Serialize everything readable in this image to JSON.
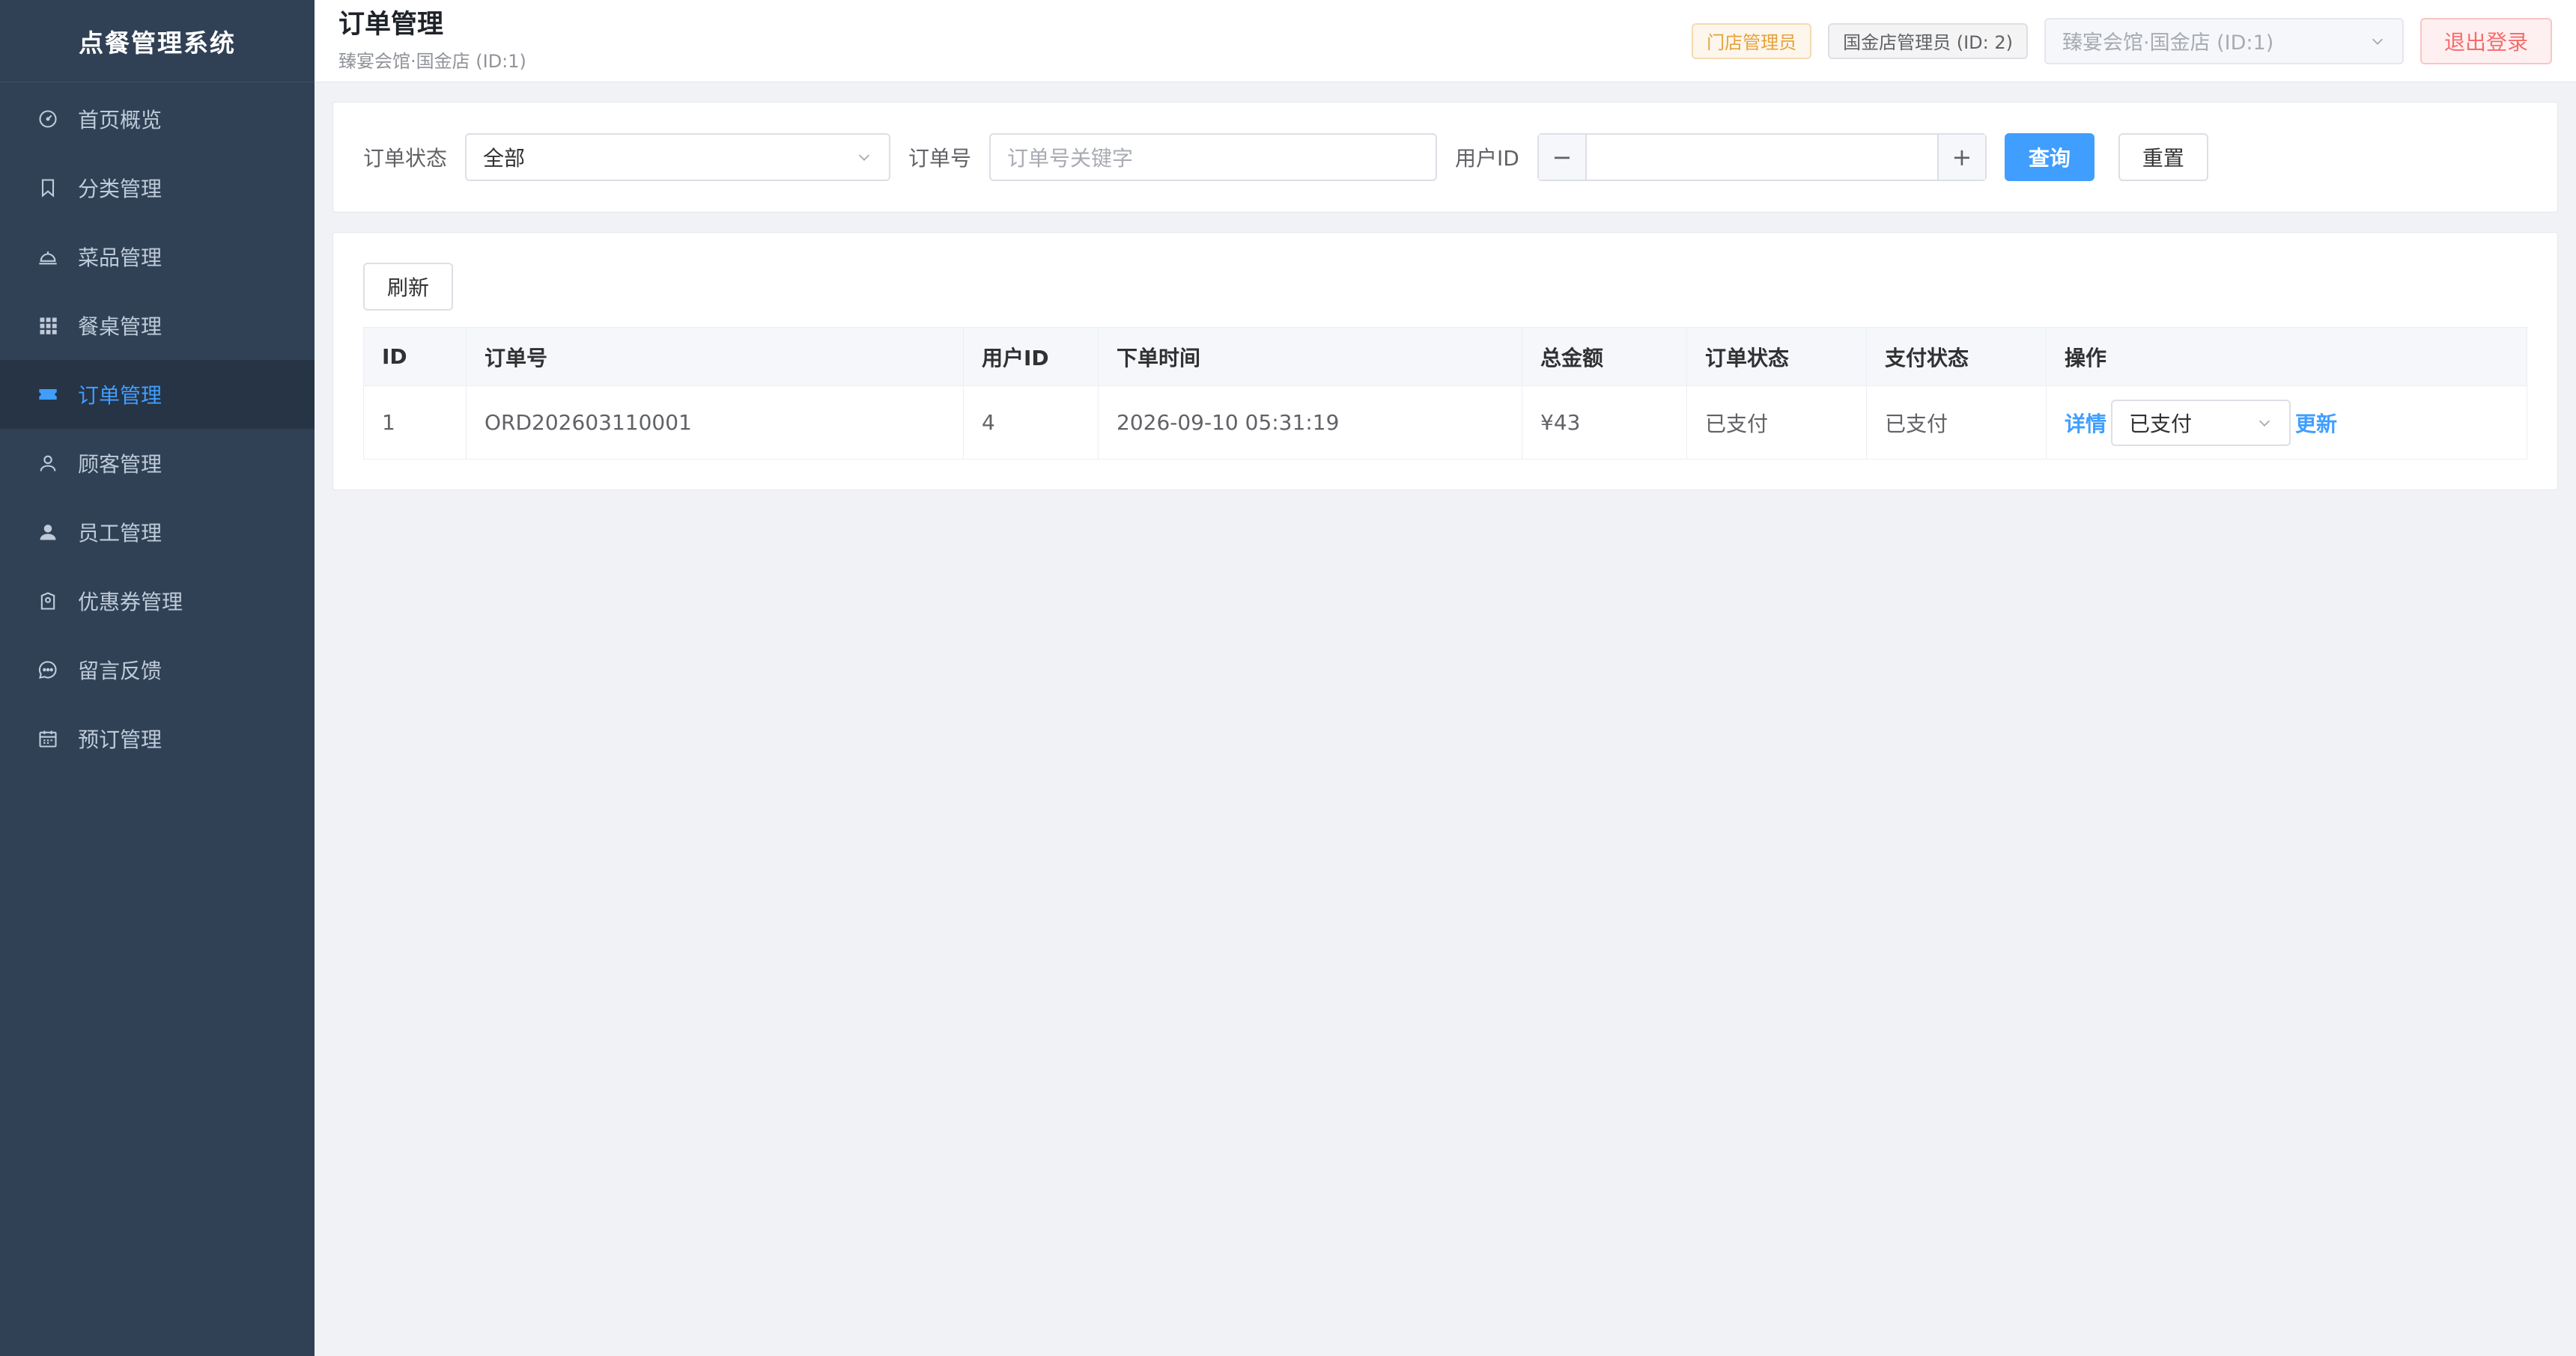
{
  "app": {
    "title": "点餐管理系统"
  },
  "sidebar": {
    "items": [
      {
        "label": "首页概览",
        "icon": "dashboard-icon",
        "active": false
      },
      {
        "label": "分类管理",
        "icon": "bookmark-icon",
        "active": false
      },
      {
        "label": "菜品管理",
        "icon": "cloche-icon",
        "active": false
      },
      {
        "label": "餐桌管理",
        "icon": "grid-icon",
        "active": false
      },
      {
        "label": "订单管理",
        "icon": "ticket-icon",
        "active": true
      },
      {
        "label": "顾客管理",
        "icon": "user-outline-icon",
        "active": false
      },
      {
        "label": "员工管理",
        "icon": "user-filled-icon",
        "active": false
      },
      {
        "label": "优惠券管理",
        "icon": "coupon-icon",
        "active": false
      },
      {
        "label": "留言反馈",
        "icon": "chat-icon",
        "active": false
      },
      {
        "label": "预订管理",
        "icon": "calendar-icon",
        "active": false
      }
    ]
  },
  "header": {
    "title": "订单管理",
    "subtitle": "臻宴会馆·国金店 (ID:1)",
    "role_tag": "门店管理员",
    "user_tag": "国金店管理员 (ID: 2)",
    "store_select": "臻宴会馆·国金店 (ID:1)",
    "logout": "退出登录"
  },
  "filter": {
    "status_label": "订单状态",
    "status_value": "全部",
    "order_no_label": "订单号",
    "order_no_placeholder": "订单号关键字",
    "user_id_label": "用户ID",
    "user_id_value": "",
    "minus": "−",
    "plus": "+",
    "query": "查询",
    "reset": "重置"
  },
  "table": {
    "refresh": "刷新",
    "headers": [
      "ID",
      "订单号",
      "用户ID",
      "下单时间",
      "总金额",
      "订单状态",
      "支付状态",
      "操作"
    ],
    "rows": [
      {
        "id": "1",
        "order_no": "ORD202603110001",
        "user_id": "4",
        "time": "2026-09-10 05:31:19",
        "amount": "¥43",
        "order_status": "已支付",
        "pay_status": "已支付",
        "detail": "详情",
        "status_select": "已支付",
        "update": "更新"
      }
    ]
  },
  "colors": {
    "sidebar_bg": "#304156",
    "accent": "#409eff",
    "danger": "#f56c6c",
    "warning": "#e6a23c"
  }
}
